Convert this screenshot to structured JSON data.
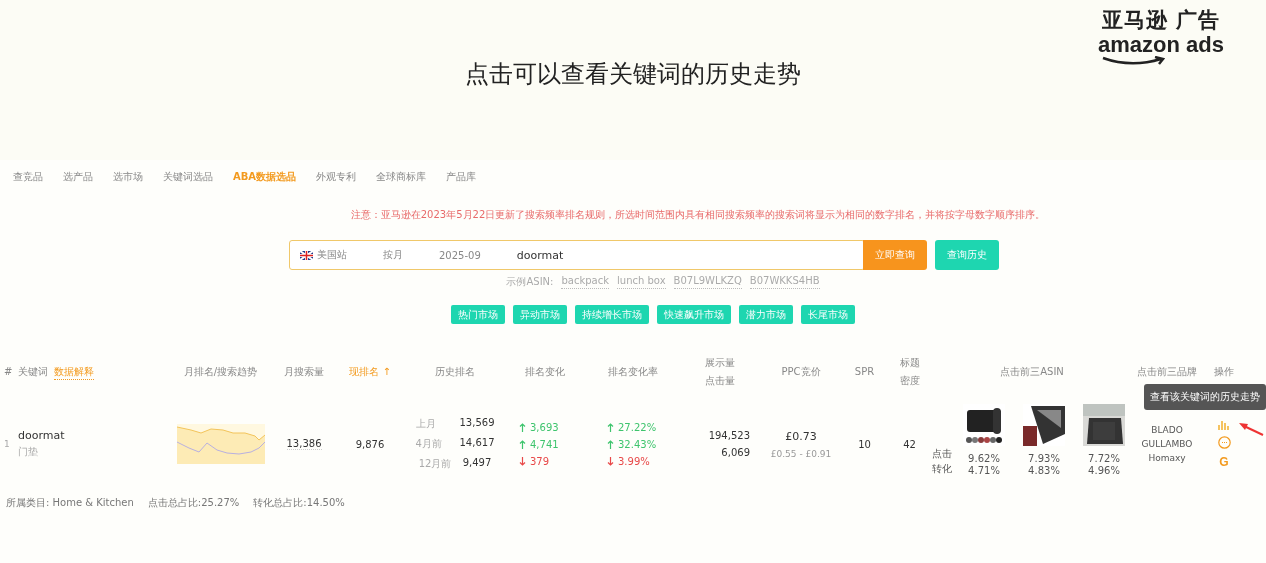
{
  "slide": {
    "title": "点击可以查看关键词的历史走势",
    "logo": {
      "cn": "亚马逊 广告",
      "en": "amazon ads"
    }
  },
  "nav": {
    "tabs": [
      {
        "label": "查竞品",
        "selected": false
      },
      {
        "label": "选产品",
        "selected": false
      },
      {
        "label": "选市场",
        "selected": false
      },
      {
        "label": "关键词选品",
        "selected": false
      },
      {
        "label": "ABA数据选品",
        "selected": true
      },
      {
        "label": "外观专利",
        "selected": false
      },
      {
        "label": "全球商标库",
        "selected": false
      },
      {
        "label": "产品库",
        "selected": false
      }
    ]
  },
  "notice": "注意：亚马逊在2023年5月22日更新了搜索频率排名规则，所选时间范围内具有相同搜索频率的搜索词将显示为相同的数字排名，并将按字母数字顺序排序。",
  "search": {
    "site": "美国站",
    "period": "按月",
    "month": "2025-09",
    "keyword": "doormat",
    "submit": "立即查询",
    "history": "查询历史"
  },
  "examples": {
    "label": "示例ASIN:",
    "items": [
      "backpack",
      "lunch box",
      "B07L9WLKZQ",
      "B07WKKS4HB"
    ]
  },
  "markets": [
    "热门市场",
    "异动市场",
    "持续增长市场",
    "快速飙升市场",
    "潜力市场",
    "长尾市场"
  ],
  "table": {
    "columns": [
      {
        "label": "#"
      },
      {
        "label": "关键词",
        "link": "数据解释"
      },
      {
        "label": "月排名/搜索趋势"
      },
      {
        "label": "月搜索量"
      },
      {
        "label": "现排名",
        "sorted": true,
        "sort_icon": "↑"
      },
      {
        "label": "历史排名"
      },
      {
        "label": "排名变化"
      },
      {
        "label": "排名变化率"
      },
      {
        "lines": [
          "展示量",
          "点击量"
        ]
      },
      {
        "label": "PPC竞价"
      },
      {
        "label": "SPR"
      },
      {
        "lines": [
          "标题",
          "密度"
        ]
      },
      {
        "label": "点击前三ASIN"
      },
      {
        "label": "点击前三品牌"
      },
      {
        "label": "操作"
      }
    ],
    "rows": [
      {
        "index": "1",
        "keyword": "doormat",
        "translation": "门垫",
        "monthly_searches": "13,386",
        "rank": "9,876",
        "history": [
          {
            "period": "上月",
            "rank": "13,569",
            "change": "3,693",
            "rate": "27.22%",
            "rising": true
          },
          {
            "period": "4月前",
            "rank": "14,617",
            "change": "4,741",
            "rate": "32.43%",
            "rising": true
          },
          {
            "period": "12月前",
            "rank": "9,497",
            "change": "379",
            "rate": "3.99%",
            "rising": false
          }
        ],
        "impressions": "194,523",
        "clicks": "6,069",
        "ppc": "£0.73",
        "ppc_range": "£0.55 - £0.91",
        "spr": "10",
        "title_density": "42",
        "asin_labels": [
          "点击",
          "转化"
        ],
        "asins": [
          {
            "kind": "picture",
            "click": "9.62%",
            "conversion": "4.71%"
          },
          {
            "kind": "picture",
            "click": "7.93%",
            "conversion": "4.83%"
          },
          {
            "kind": "picture",
            "click": "7.72%",
            "conversion": "4.96%"
          }
        ],
        "brands": [
          "BLADO",
          "GULLAMBO",
          "Homaxy"
        ],
        "actions": [
          {
            "kind": "chart"
          },
          {
            "kind": "more"
          },
          {
            "kind": "google",
            "label": "G"
          }
        ],
        "tooltip": "查看该关键词的历史走势"
      }
    ]
  },
  "footer": {
    "category": "所属类目: Home & Kitchen",
    "click_share": "点击总占比:25.27%",
    "conversion_share": "转化总占比:14.50%"
  }
}
